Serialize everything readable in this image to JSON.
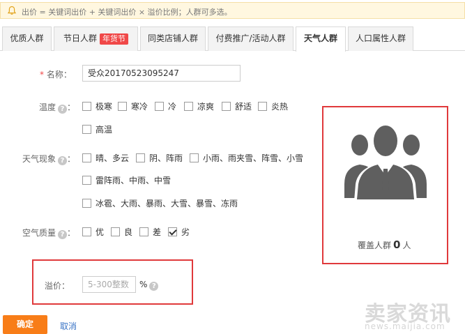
{
  "notice": {
    "text": "出价 = 关键词出价 + 关键词出价 × 溢价比例；人群可多选。"
  },
  "tabs": [
    {
      "label": "优质人群",
      "active": false
    },
    {
      "label": "节日人群",
      "badge": "年货节",
      "active": false
    },
    {
      "label": "同类店铺人群",
      "active": false
    },
    {
      "label": "付费推广/活动人群",
      "active": false
    },
    {
      "label": "天气人群",
      "active": true
    },
    {
      "label": "人口属性人群",
      "active": false
    }
  ],
  "form": {
    "name_label": "名称：",
    "name_value": "受众20170523095247",
    "temperature_label": "温度",
    "temperature_options": [
      "极寒",
      "寒冷",
      "冷",
      "凉爽",
      "舒适",
      "炎热",
      "高温"
    ],
    "weather_label": "天气现象",
    "weather_options": [
      "晴、多云",
      "阴、阵雨",
      "小雨、雨夹雪、阵雪、小雪",
      "雷阵雨、中雨、中雪",
      "冰雹、大雨、暴雨、大雪、暴雪、冻雨"
    ],
    "air_label": "空气质量",
    "air_options": [
      {
        "label": "优",
        "checked": false
      },
      {
        "label": "良",
        "checked": false
      },
      {
        "label": "差",
        "checked": false
      },
      {
        "label": "劣",
        "checked": true
      }
    ],
    "colon": "：",
    "premium_label": "溢价：",
    "premium_placeholder": "5-300整数",
    "premium_unit": "%"
  },
  "coverage": {
    "prefix": "覆盖人群",
    "count": "0",
    "suffix": "人"
  },
  "actions": {
    "confirm": "确定",
    "cancel": "取消"
  },
  "watermark": {
    "logo": "卖家资讯",
    "url": "news.maijia.com"
  },
  "colors": {
    "accent": "#f87d18",
    "badge": "#f04848",
    "highlight_frame": "#e0393b",
    "link": "#3a74c6"
  }
}
